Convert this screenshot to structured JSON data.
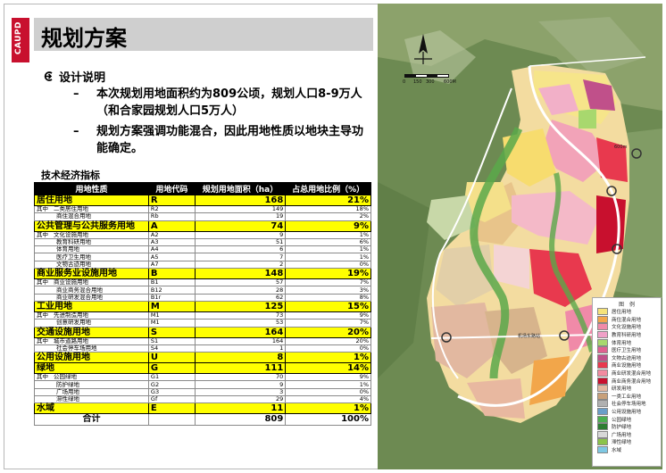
{
  "slide": {
    "badge": "CAUPD",
    "title": "规划方案",
    "section_label": "设计说明",
    "points": [
      "本次规划用地面积约为809公顷，规划人口8-9万人（和合家园规划人口5万人）",
      "规划方案强调功能混合，因此用地性质以地块主导功能确定。"
    ],
    "table_title": "技术经济指标"
  },
  "table": {
    "headers": [
      "用地性质",
      "用地代码",
      "规划用地面积（ha）",
      "占总用地比例（%）"
    ],
    "sub_prefix": "其中",
    "groups": [
      {
        "name": "居住用地",
        "code": "R",
        "area": "168",
        "pct": "21%",
        "subs": [
          [
            "二类居住用地",
            "R2",
            "149",
            "18%"
          ],
          [
            "商住混合用地",
            "Rb",
            "19",
            "2%"
          ]
        ]
      },
      {
        "name": "公共管理与公共服务用地",
        "code": "A",
        "area": "74",
        "pct": "9%",
        "subs": [
          [
            "文化设施用地",
            "A2",
            "9",
            "1%"
          ],
          [
            "教育科研用地",
            "A3",
            "51",
            "6%"
          ],
          [
            "体育用地",
            "A4",
            "6",
            "1%"
          ],
          [
            "医疗卫生用地",
            "A5",
            "7",
            "1%"
          ],
          [
            "文物古迹用地",
            "A7",
            "2",
            "0%"
          ]
        ]
      },
      {
        "name": "商业服务业设施用地",
        "code": "B",
        "area": "148",
        "pct": "19%",
        "subs": [
          [
            "商业设施用地",
            "B1",
            "57",
            "7%"
          ],
          [
            "商业商务混合用地",
            "B12",
            "28",
            "3%"
          ],
          [
            "商业研发混合用地",
            "B1r",
            "62",
            "8%"
          ]
        ]
      },
      {
        "name": "工业用地",
        "code": "M",
        "area": "125",
        "pct": "15%",
        "subs": [
          [
            "先进制造用地",
            "M1",
            "73",
            "9%"
          ],
          [
            "创意研发用地",
            "M1",
            "53",
            "7%"
          ]
        ]
      },
      {
        "name": "交通设施用地",
        "code": "S",
        "area": "164",
        "pct": "20%",
        "subs": [
          [
            "城市道路用地",
            "S1",
            "164",
            "20%"
          ],
          [
            "社会停车场用地",
            "S4",
            "1",
            "0%"
          ]
        ]
      },
      {
        "name": "公用设施用地",
        "code": "U",
        "area": "8",
        "pct": "1%",
        "subs": []
      },
      {
        "name": "绿地",
        "code": "G",
        "area": "111",
        "pct": "14%",
        "subs": [
          [
            "公园绿地",
            "G1",
            "70",
            "9%"
          ],
          [
            "防护绿地",
            "G2",
            "9",
            "1%"
          ],
          [
            "广场用地",
            "G3",
            "3",
            "0%"
          ],
          [
            "滞性绿地",
            "Gf",
            "29",
            "4%"
          ]
        ]
      },
      {
        "name": "水域",
        "code": "E",
        "area": "11",
        "pct": "1%",
        "subs": []
      }
    ],
    "total_label": "合计",
    "total_area": "809",
    "total_pct": "100%"
  },
  "map": {
    "scale_labels": [
      "0",
      "150",
      "300",
      "600M"
    ],
    "distance_label": "600m",
    "station_label": "机场东路站",
    "legend_title": "图　例",
    "legend": [
      {
        "label": "居住用地",
        "color": "#f5e27a"
      },
      {
        "label": "商住混合用地",
        "color": "#f2a64a"
      },
      {
        "label": "文化设施用地",
        "color": "#f08aa8"
      },
      {
        "label": "教育科研用地",
        "color": "#f0a0c8"
      },
      {
        "label": "体育用地",
        "color": "#a8d86e"
      },
      {
        "label": "医疗卫生用地",
        "color": "#e06090"
      },
      {
        "label": "文物古迹用地",
        "color": "#c0508a"
      },
      {
        "label": "商业设施用地",
        "color": "#e8394e"
      },
      {
        "label": "商业研发混合用地",
        "color": "#f28ba0"
      },
      {
        "label": "商业商务混合用地",
        "color": "#c8102e"
      },
      {
        "label": "研发用地",
        "color": "#e2b8a0"
      },
      {
        "label": "一类工业用地",
        "color": "#c8a07a"
      },
      {
        "label": "社会停车场用地",
        "color": "#b0b0b0"
      },
      {
        "label": "公用设施用地",
        "color": "#6a9ec8"
      },
      {
        "label": "公园绿地",
        "color": "#4caf50"
      },
      {
        "label": "防护绿地",
        "color": "#2e7d32"
      },
      {
        "label": "广场用地",
        "color": "#d8d8d8"
      },
      {
        "label": "滞性绿地",
        "color": "#8bc34a"
      },
      {
        "label": "水域",
        "color": "#7ec8e3"
      }
    ]
  }
}
